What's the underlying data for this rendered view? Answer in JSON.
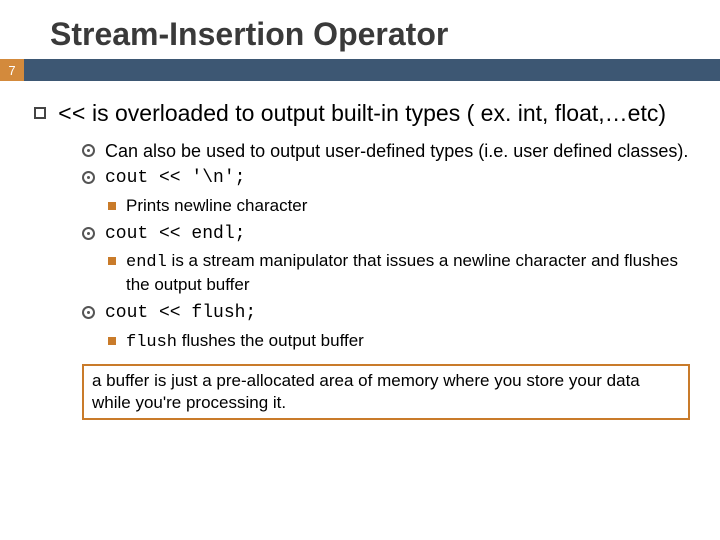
{
  "title": "Stream-Insertion Operator",
  "slide_number": "7",
  "main_before": "<<",
  "main_after": " is overloaded to output built-in types ( ex. int, float,…etc)",
  "b1": "Can also be used to output user-defined types (i.e. user defined classes).",
  "b2": "cout << '\\n';",
  "b2a": "Prints newline character",
  "b3": "cout << endl;",
  "b3a_mono": "endl",
  "b3a_rest": " is a stream manipulator that issues a newline character and flushes the output buffer",
  "b4": "cout << flush;",
  "b4a_mono": "flush",
  "b4a_rest": " flushes the output buffer",
  "callout": "a buffer is just a pre-allocated area of memory where you store your data while you're processing it."
}
